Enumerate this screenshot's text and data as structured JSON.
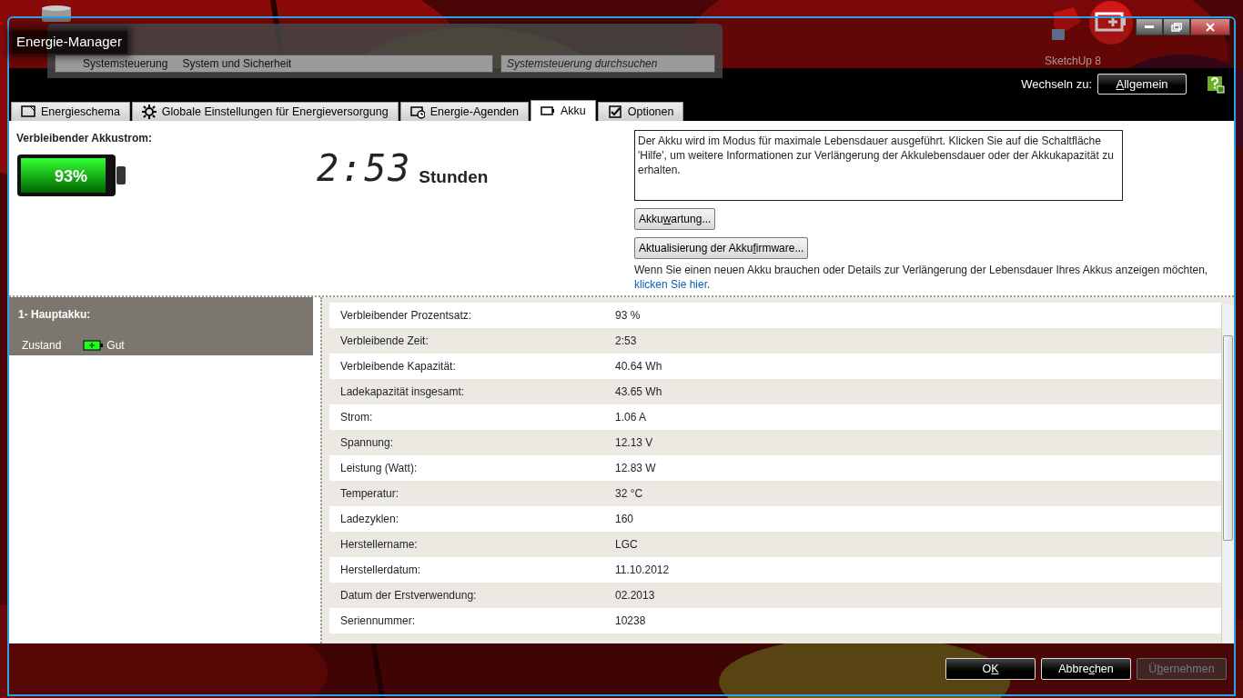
{
  "desktop": {
    "icons": [
      {
        "label": "SketchUp 8"
      }
    ]
  },
  "background_window": {
    "breadcrumb": [
      "Systemsteuerung",
      "System und Sicherheit"
    ],
    "search": {
      "placeholder": "Systemsteuerung durchsuchen"
    }
  },
  "window": {
    "title": "Energie-Manager"
  },
  "toolbar": {
    "switch_label": "Wechseln zu:",
    "switch_button": {
      "access_key": "A",
      "post": "llgemein"
    }
  },
  "tabs": [
    {
      "label": "Energieschema",
      "kind": "scheme",
      "selected": false
    },
    {
      "label": "Globale Einstellungen für Energieversorgung",
      "kind": "gear",
      "selected": false
    },
    {
      "label": "Energie-Agenden",
      "kind": "agenda",
      "selected": false
    },
    {
      "label": "Akku",
      "kind": "battery",
      "selected": true
    },
    {
      "label": "Optionen",
      "kind": "check",
      "selected": false
    }
  ],
  "battery_panel": {
    "heading": "Verbleibender Akkustrom:",
    "level": 0.93,
    "percent": "93%",
    "time": "2:53",
    "time_unit": "Stunden",
    "message": "Der Akku wird im Modus für maximale Lebensdauer ausgeführt. Klicken Sie auf die Schaltfläche 'Hilfe', um weitere Informationen zur Verlängerung der Akkulebensdauer oder der Akkukapazität zu erhalten.",
    "buttons": [
      {
        "pre": "Akku",
        "access_key": "w",
        "post": "artung..."
      },
      {
        "pre": "Aktualisierung der Akku",
        "access_key": "f",
        "post": "irmware..."
      }
    ],
    "note": "Wenn Sie einen neuen Akku brauchen oder Details zur Verlängerung der Lebensdauer Ihres Akkus anzeigen möchten,",
    "link": "klicken Sie hier",
    "note_end": "."
  },
  "batteries": [
    {
      "name": "1- Hauptakku:",
      "status_label": "Zustand",
      "status": "Gut",
      "selected": true
    }
  ],
  "details": {
    "rows": [
      {
        "label": "Verbleibender Prozentsatz:",
        "value": "93 %"
      },
      {
        "label": "Verbleibende Zeit:",
        "value": "2:53"
      },
      {
        "label": "Verbleibende Kapazität:",
        "value": "40.64 Wh"
      },
      {
        "label": "Ladekapazität insgesamt:",
        "value": "43.65 Wh"
      },
      {
        "label": "Strom:",
        "value": "1.06 A"
      },
      {
        "label": "Spannung:",
        "value": "12.13 V"
      },
      {
        "label": "Leistung (Watt):",
        "value": "12.83 W"
      },
      {
        "label": "Temperatur:",
        "value": "32 °C"
      },
      {
        "label": "Ladezyklen:",
        "value": "160"
      },
      {
        "label": "Herstellername:",
        "value": "LGC"
      },
      {
        "label": "Herstellerdatum:",
        "value": "11.10.2012"
      },
      {
        "label": "Datum der Erstverwendung:",
        "value": "02.2013"
      },
      {
        "label": "Seriennummer:",
        "value": "10238"
      }
    ]
  },
  "footer_buttons": [
    {
      "pre": "O",
      "access_key": "K",
      "disabled": false
    },
    {
      "pre": "Abbre",
      "access_key": "c",
      "post": "hen",
      "disabled": false
    },
    {
      "pre": "Ü",
      "access_key": "b",
      "post": "ernehmen",
      "disabled": true
    }
  ]
}
